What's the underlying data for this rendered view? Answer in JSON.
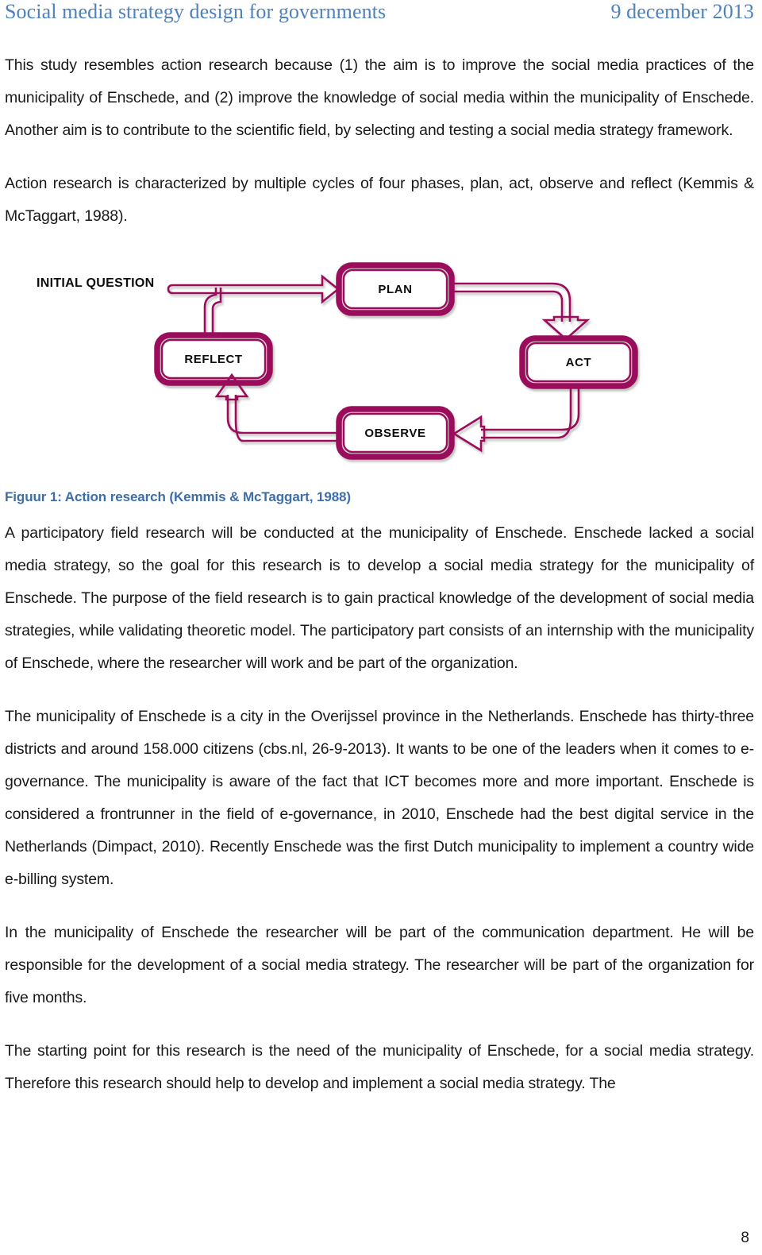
{
  "header": {
    "title": "Social media strategy design for governments",
    "date": "9 december 2013",
    "color": "#4F81BD"
  },
  "paragraphs": {
    "p1": "This study resembles action research because (1) the aim is to improve the social media practices of the municipality of Enschede, and (2) improve the knowledge of social media within the municipality of Enschede. Another aim is to contribute to the scientific field, by selecting and testing a social media strategy framework.",
    "p2": "Action research is characterized by multiple cycles of four phases, plan, act, observe and reflect (Kemmis & McTaggart, 1988).",
    "p3": "A participatory field research will be conducted at the municipality of Enschede. Enschede lacked a social media strategy, so the goal for this research is to develop a social media strategy for the municipality of Enschede. The purpose of the field research is to gain practical knowledge of the development of social media strategies, while validating theoretic model. The participatory part consists of an internship with the municipality of Enschede, where the researcher will work and be part of the organization.",
    "p4": "The municipality of Enschede is a city in the Overijssel province in the Netherlands. Enschede has thirty-three districts and around 158.000 citizens (cbs.nl, 26-9-2013). It wants to be one of the leaders when it comes to e-governance. The municipality is aware of the fact that ICT becomes more and more important. Enschede is considered a frontrunner in the field of e-governance, in 2010, Enschede had the best digital service in the Netherlands (Dimpact, 2010). Recently Enschede was the first Dutch municipality to implement a country wide e-billing system.",
    "p5": "In the municipality of Enschede the researcher will be part of the communication department. He will be responsible for the development of a social media strategy. The researcher will be part of the organization for five months.",
    "p6": "The starting point for this research is the need of the municipality of Enschede, for a  social media strategy. Therefore this research should help to develop and implement a social media strategy. The"
  },
  "figure": {
    "caption": "Figuur 1: Action research (Kemmis & McTaggart, 1988)",
    "caption_color": "#3E6DA8",
    "line_color": "#9B0F5B",
    "entry_label": "INITIAL QUESTION",
    "nodes": [
      {
        "id": "plan",
        "label": "PLAN"
      },
      {
        "id": "act",
        "label": "ACT"
      },
      {
        "id": "observe",
        "label": "OBSERVE"
      },
      {
        "id": "reflect",
        "label": "REFLECT"
      }
    ],
    "flow": [
      "INITIAL QUESTION",
      "PLAN",
      "ACT",
      "OBSERVE",
      "REFLECT"
    ]
  },
  "footer": {
    "page_number": "8"
  }
}
